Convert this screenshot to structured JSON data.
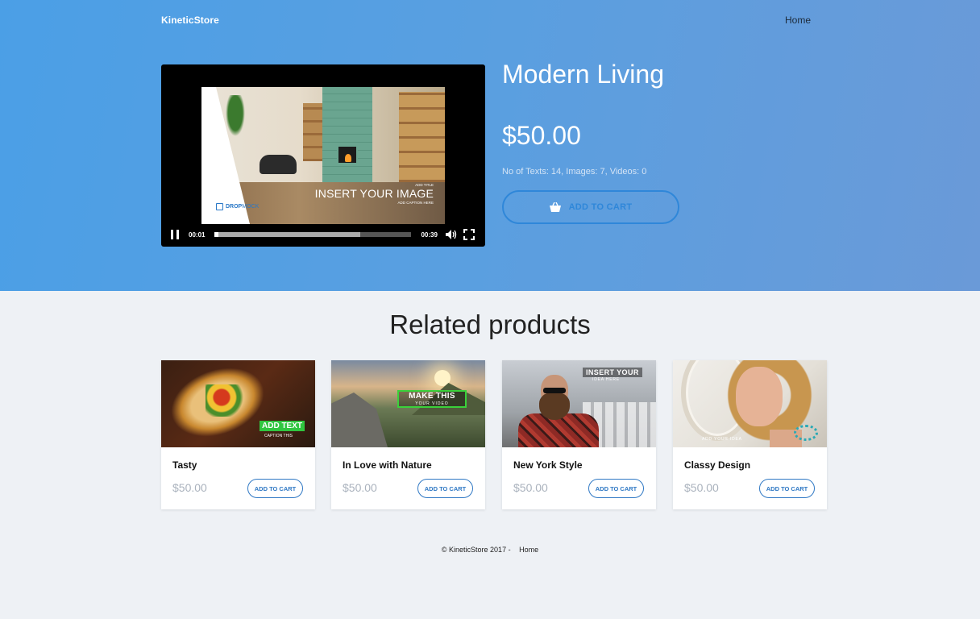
{
  "nav": {
    "brand": "KineticStore",
    "home": "Home"
  },
  "product": {
    "title": "Modern Living",
    "price": "$50.00",
    "meta": "No of Texts: 14, Images: 7, Videos: 0",
    "add_to_cart": "ADD TO CART"
  },
  "player": {
    "current_time": "00:01",
    "end_time": "00:39",
    "played_fraction": 0.02,
    "buffered_fraction": 0.74,
    "frame": {
      "insert_text": "INSERT YOUR IMAGE",
      "add_title": "ADD TITLE",
      "add_caption": "ADD CAPTION HERE",
      "logo_bold": "DROP",
      "logo_light": "MOCK"
    }
  },
  "related": {
    "title": "Related products",
    "items": [
      {
        "name": "Tasty",
        "price": "$50.00",
        "button": "ADD TO CART",
        "overlay_big": "ADD TEXT",
        "overlay_small": "CAPTION THIS"
      },
      {
        "name": "In Love with Nature",
        "price": "$50.00",
        "button": "ADD TO CART",
        "overlay_big": "MAKE THIS",
        "overlay_small": "YOUR VIDEO"
      },
      {
        "name": "New York Style",
        "price": "$50.00",
        "button": "ADD TO CART",
        "overlay_big": "INSERT YOUR",
        "overlay_small": "IDEA HERE"
      },
      {
        "name": "Classy Design",
        "price": "$50.00",
        "button": "ADD TO CART",
        "overlay_big": "",
        "overlay_small": "ADD YOUR IDEA"
      }
    ]
  },
  "footer": {
    "copyright": "© KineticStore 2017 -",
    "home": "Home"
  },
  "colors": {
    "hero_start": "#4b9fe6",
    "hero_end": "#6a9ad8",
    "accent": "#2f87d9",
    "page_bg": "#eef1f5"
  }
}
